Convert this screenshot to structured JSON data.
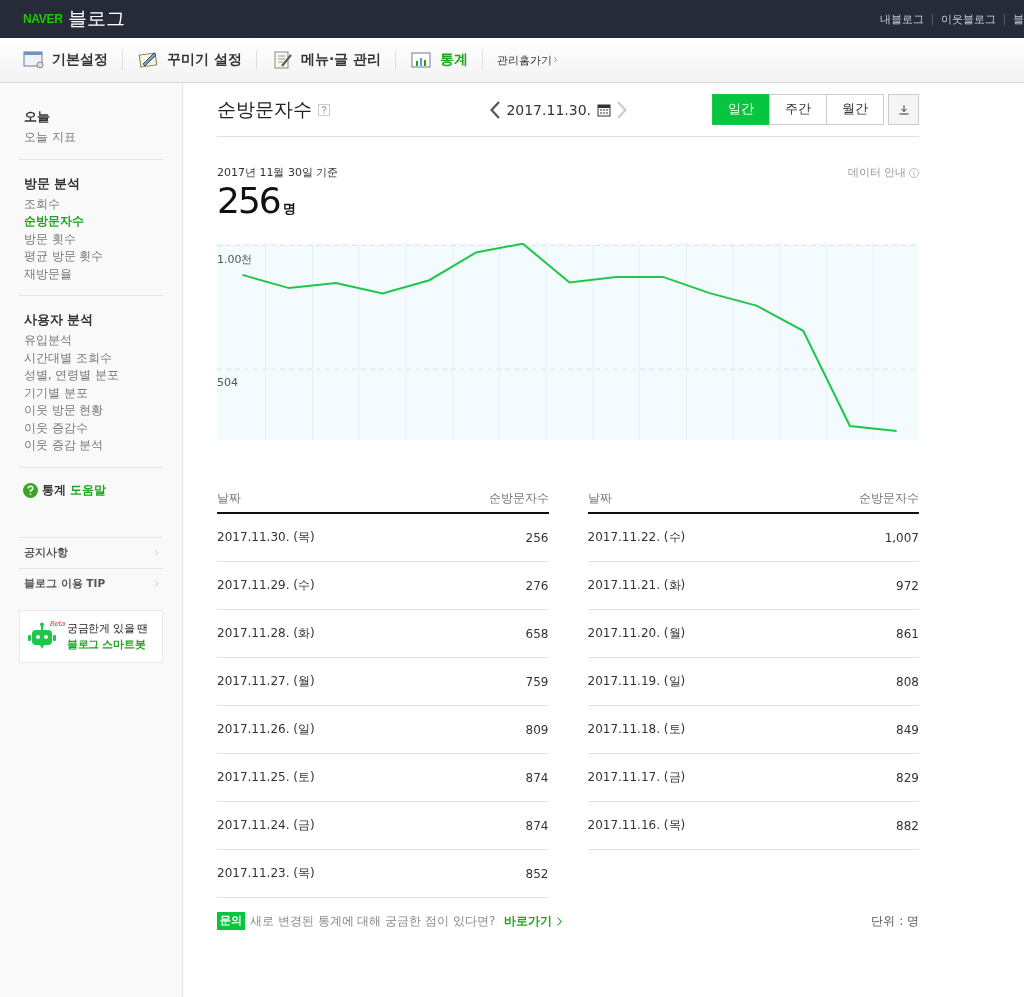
{
  "header": {
    "logo": "NAVER",
    "brand": "블로그",
    "links": [
      "내블로그",
      "이웃블로그",
      "블"
    ]
  },
  "nav": {
    "tabs": [
      {
        "label": "기본설정",
        "kind": "settings",
        "selected": false
      },
      {
        "label": "꾸미기 설정",
        "kind": "decorate",
        "selected": false
      },
      {
        "label": "메뉴·글 관리",
        "kind": "notes",
        "selected": false
      },
      {
        "label": "통계",
        "kind": "stats",
        "selected": true
      }
    ],
    "manage_link": "관리홈가기"
  },
  "sidebar": {
    "sections": [
      {
        "title": "오늘",
        "items": [
          {
            "label": "오늘 지표",
            "selected": false
          }
        ]
      },
      {
        "title": "방문 분석",
        "items": [
          {
            "label": "조회수",
            "selected": false
          },
          {
            "label": "순방문자수",
            "selected": true
          },
          {
            "label": "방문 횟수",
            "selected": false
          },
          {
            "label": "평균 방문 횟수",
            "selected": false
          },
          {
            "label": "재방문율",
            "selected": false
          }
        ]
      },
      {
        "title": "사용자 분석",
        "items": [
          {
            "label": "유입분석",
            "selected": false
          },
          {
            "label": "시간대별 조회수",
            "selected": false
          },
          {
            "label": "성별, 연령별 분포",
            "selected": false
          },
          {
            "label": "기기별 분포",
            "selected": false
          },
          {
            "label": "이웃 방문 현황",
            "selected": false
          },
          {
            "label": "이웃 증감수",
            "selected": false
          },
          {
            "label": "이웃 증감 분석",
            "selected": false
          }
        ]
      }
    ],
    "help": {
      "prefix": "통계",
      "link": "도움말"
    },
    "links": [
      "공지사항",
      "블로그 이용 TIP"
    ],
    "bot": {
      "badge": "Beta",
      "line1": "궁금한게 있을 땐",
      "line2": "블로그 스마트봇"
    }
  },
  "main": {
    "title": "순방문자수",
    "date": "2017.11.30.",
    "periods": [
      {
        "label": "일간",
        "selected": true
      },
      {
        "label": "주간",
        "selected": false
      },
      {
        "label": "월간",
        "selected": false
      }
    ],
    "basis": "2017년 11월 30일 기준",
    "total": "256",
    "unit": "명",
    "data_info": "데이터 안내",
    "chart": {
      "axis_labels": [
        "1.00천",
        "504"
      ]
    },
    "tables": [
      {
        "columns": [
          "날짜",
          "순방문자수"
        ],
        "rows": [
          [
            "2017.11.30. (목)",
            "256"
          ],
          [
            "2017.11.29. (수)",
            "276"
          ],
          [
            "2017.11.28. (화)",
            "658"
          ],
          [
            "2017.11.27. (월)",
            "759"
          ],
          [
            "2017.11.26. (일)",
            "809"
          ],
          [
            "2017.11.25. (토)",
            "874"
          ],
          [
            "2017.11.24. (금)",
            "874"
          ],
          [
            "2017.11.23. (목)",
            "852"
          ]
        ]
      },
      {
        "columns": [
          "날짜",
          "순방문자수"
        ],
        "rows": [
          [
            "2017.11.22. (수)",
            "1,007"
          ],
          [
            "2017.11.21. (화)",
            "972"
          ],
          [
            "2017.11.20. (월)",
            "861"
          ],
          [
            "2017.11.19. (일)",
            "808"
          ],
          [
            "2017.11.18. (토)",
            "849"
          ],
          [
            "2017.11.17. (금)",
            "829"
          ],
          [
            "2017.11.16. (목)",
            "882"
          ]
        ]
      }
    ],
    "footer": {
      "badge": "문의",
      "text": "새로 변경된 통계에 대해 궁금한 점이 있다면?",
      "link": "바로가기",
      "unit_note": "단위 : 명"
    }
  }
}
